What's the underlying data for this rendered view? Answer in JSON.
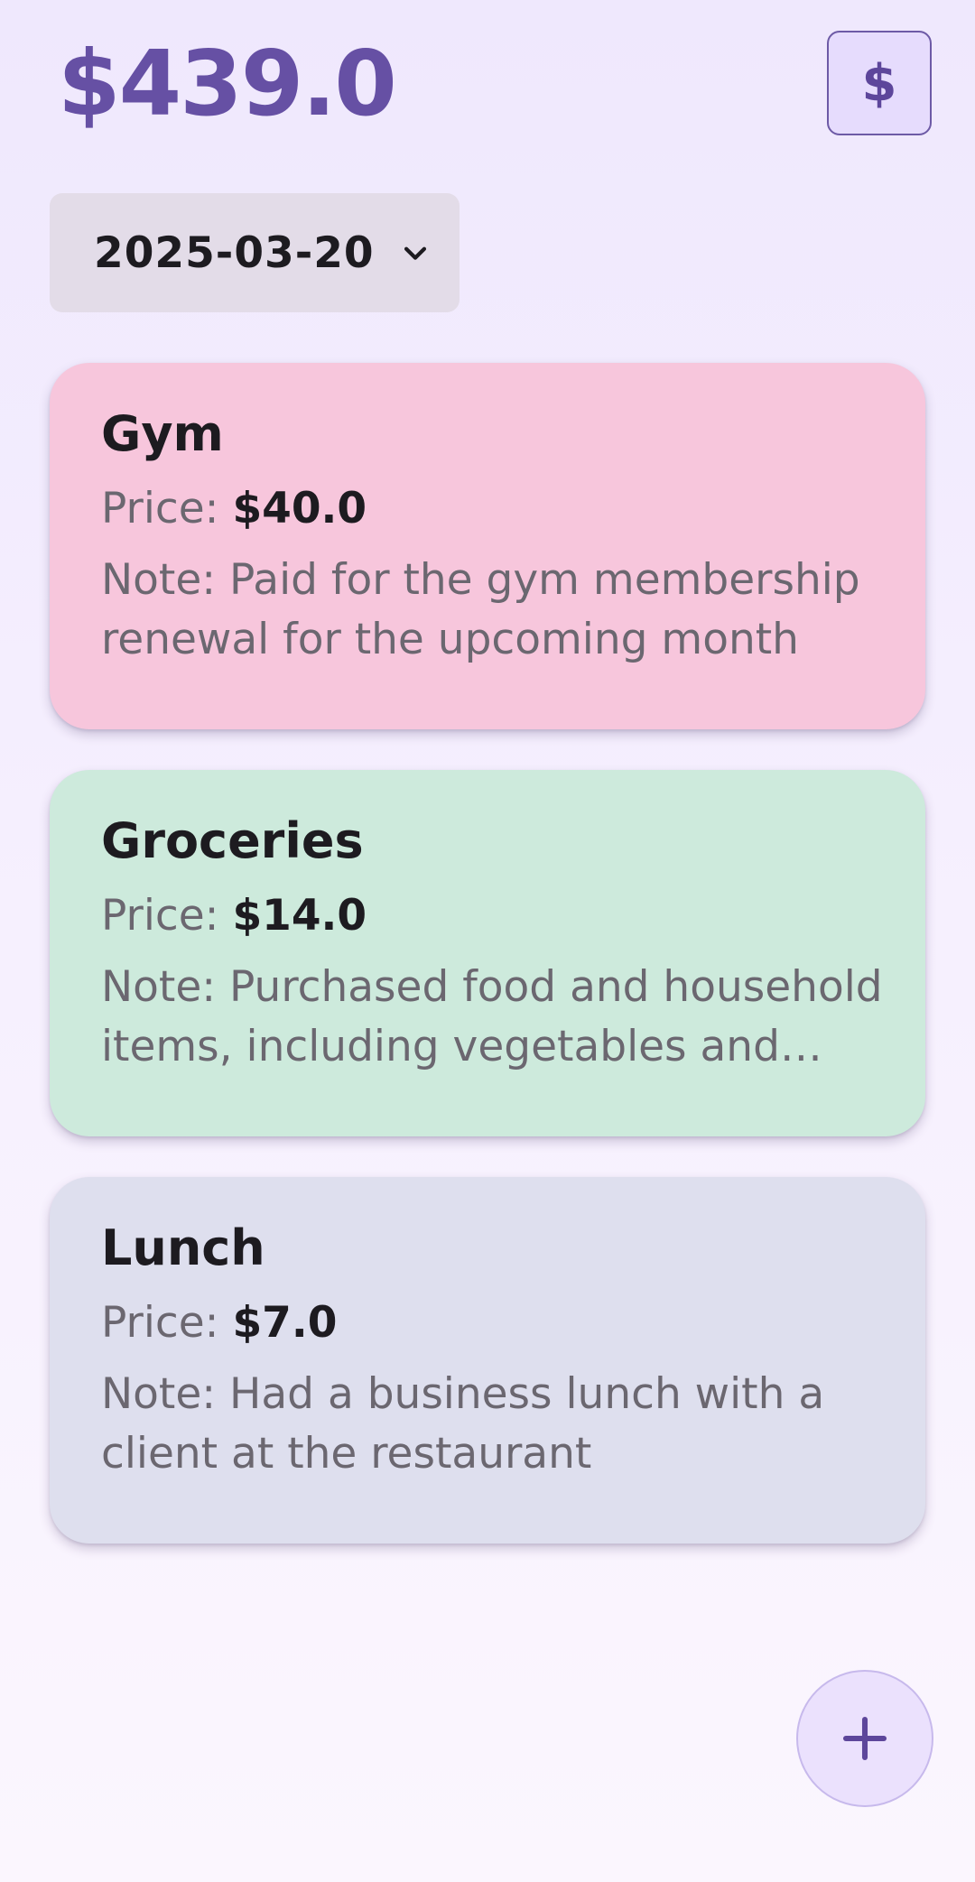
{
  "header": {
    "total": "$439.0",
    "currency_button_label": "$"
  },
  "date_filter": {
    "selected": "2025-03-20"
  },
  "expenses": [
    {
      "title": "Gym",
      "price_label": "Price:",
      "price": "$40.0",
      "note": "Note: Paid for the gym membership renewal for the upcoming month",
      "color": "#f7c6dc"
    },
    {
      "title": "Groceries",
      "price_label": "Price:",
      "price": "$14.0",
      "note": "Note: Purchased food and household items, including vegetables and fruits",
      "color": "#cdeadc"
    },
    {
      "title": "Lunch",
      "price_label": "Price:",
      "price": "$7.0",
      "note": "Note: Had a business lunch with a client at the restaurant",
      "color": "#dedfee"
    }
  ],
  "icons": {
    "currency": "dollar-icon",
    "dropdown": "chevron-down-icon",
    "add": "plus-icon"
  },
  "colors": {
    "accent": "#6650a4"
  }
}
